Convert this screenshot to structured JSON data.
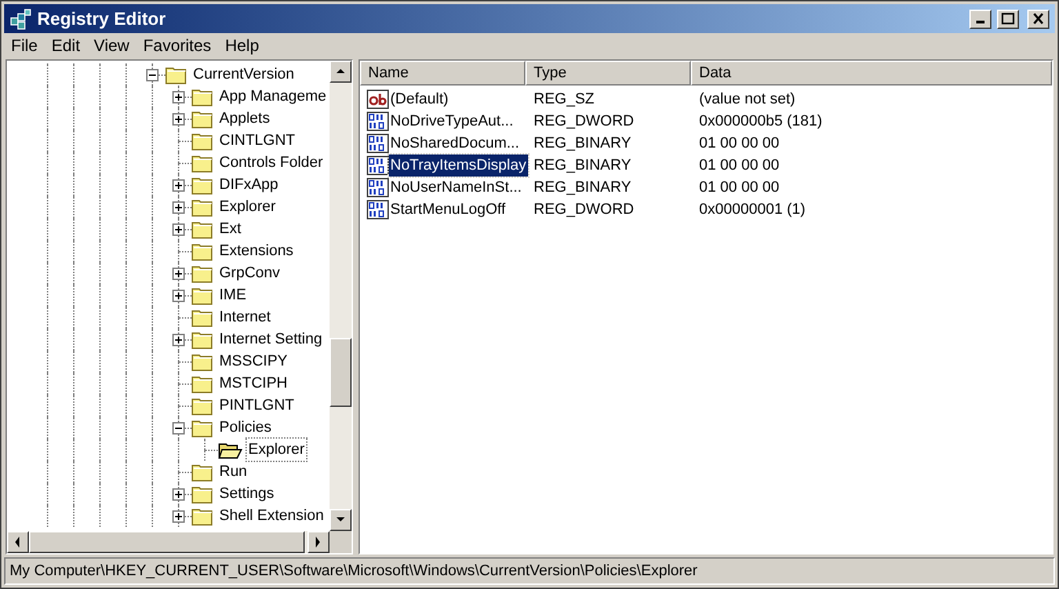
{
  "window": {
    "title": "Registry Editor"
  },
  "menu": [
    "File",
    "Edit",
    "View",
    "Favorites",
    "Help"
  ],
  "tree": [
    {
      "label": "CurrentVersion",
      "kind": "expanded",
      "selected": false,
      "children": [
        {
          "label": "App Manageme",
          "kind": "collapsed",
          "selected": false
        },
        {
          "label": "Applets",
          "kind": "collapsed",
          "selected": false
        },
        {
          "label": "CINTLGNT",
          "kind": "leaf",
          "selected": false
        },
        {
          "label": "Controls Folder",
          "kind": "leaf",
          "selected": false
        },
        {
          "label": "DIFxApp",
          "kind": "collapsed",
          "selected": false
        },
        {
          "label": "Explorer",
          "kind": "collapsed",
          "selected": false
        },
        {
          "label": "Ext",
          "kind": "collapsed",
          "selected": false
        },
        {
          "label": "Extensions",
          "kind": "leaf",
          "selected": false
        },
        {
          "label": "GrpConv",
          "kind": "collapsed",
          "selected": false
        },
        {
          "label": "IME",
          "kind": "collapsed",
          "selected": false
        },
        {
          "label": "Internet",
          "kind": "leaf",
          "selected": false
        },
        {
          "label": "Internet Setting",
          "kind": "collapsed",
          "selected": false
        },
        {
          "label": "MSSCIPY",
          "kind": "leaf",
          "selected": false
        },
        {
          "label": "MSTCIPH",
          "kind": "leaf",
          "selected": false
        },
        {
          "label": "PINTLGNT",
          "kind": "leaf",
          "selected": false
        },
        {
          "label": "Policies",
          "kind": "expanded",
          "selected": false,
          "children": [
            {
              "label": "Explorer",
              "kind": "leaf",
              "selected": true
            }
          ]
        },
        {
          "label": "Run",
          "kind": "leaf",
          "selected": false
        },
        {
          "label": "Settings",
          "kind": "collapsed",
          "selected": false
        },
        {
          "label": "Shell Extension",
          "kind": "collapsed",
          "selected": false
        }
      ]
    }
  ],
  "table": {
    "columns": [
      "Name",
      "Type",
      "Data"
    ],
    "rows": [
      {
        "name": "(Default)",
        "type": "REG_SZ",
        "data": "(value not set)",
        "kind": "string",
        "selected": false
      },
      {
        "name": "NoDriveTypeAut...",
        "type": "REG_DWORD",
        "data": "0x000000b5 (181)",
        "kind": "binary",
        "selected": false
      },
      {
        "name": "NoSharedDocum...",
        "type": "REG_BINARY",
        "data": "01 00 00 00",
        "kind": "binary",
        "selected": false
      },
      {
        "name": "NoTrayItemsDisplay",
        "type": "REG_BINARY",
        "data": "01 00 00 00",
        "kind": "binary",
        "selected": true
      },
      {
        "name": "NoUserNameInSt...",
        "type": "REG_BINARY",
        "data": "01 00 00 00",
        "kind": "binary",
        "selected": false
      },
      {
        "name": "StartMenuLogOff",
        "type": "REG_DWORD",
        "data": "0x00000001 (1)",
        "kind": "binary",
        "selected": false
      }
    ]
  },
  "status_bar": "My Computer\\HKEY_CURRENT_USER\\Software\\Microsoft\\Windows\\CurrentVersion\\Policies\\Explorer"
}
